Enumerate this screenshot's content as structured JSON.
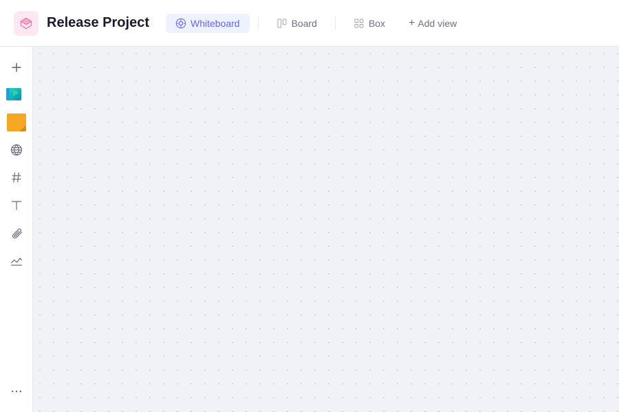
{
  "header": {
    "project_name": "Release Project",
    "tabs": [
      {
        "id": "whiteboard",
        "label": "Whiteboard",
        "active": true
      },
      {
        "id": "board",
        "label": "Board",
        "active": false
      },
      {
        "id": "box",
        "label": "Box",
        "active": false
      }
    ],
    "add_view_label": "Add view"
  },
  "sidebar": {
    "items": [
      {
        "id": "add",
        "icon": "plus-icon",
        "label": "Add"
      },
      {
        "id": "media",
        "icon": "media-icon",
        "label": "Media"
      },
      {
        "id": "sticky",
        "icon": "sticky-icon",
        "label": "Sticky Note"
      },
      {
        "id": "globe",
        "icon": "globe-icon",
        "label": "Globe"
      },
      {
        "id": "hashtag",
        "icon": "hashtag-icon",
        "label": "Hashtag"
      },
      {
        "id": "text",
        "icon": "text-icon",
        "label": "Text"
      },
      {
        "id": "attachment",
        "icon": "attachment-icon",
        "label": "Attachment"
      },
      {
        "id": "pen",
        "icon": "pen-icon",
        "label": "Pen"
      },
      {
        "id": "more",
        "icon": "more-icon",
        "label": "More"
      }
    ]
  },
  "canvas": {
    "background": "#f0f2f5",
    "dot_color": "#c8cdd6"
  }
}
